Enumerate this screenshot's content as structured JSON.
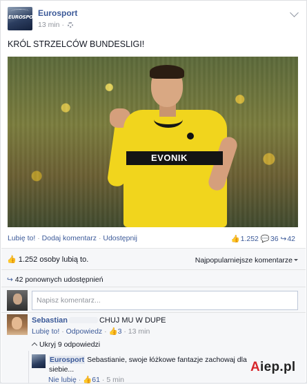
{
  "post": {
    "page_name": "Eurosport",
    "logo_text": "EUROSPORT",
    "timestamp": "13 min",
    "meta_sep": "·",
    "text": "KRÓL STRZELCÓW BUNDESLIGI!",
    "photo_icon": "player-photo",
    "photo_sponsor": "EVONIK"
  },
  "actions": {
    "like": "Lubię to!",
    "comment": "Dodaj komentarz",
    "share": "Udostępnij",
    "sep": "·",
    "like_count": "1.252",
    "comment_count": "36",
    "share_count": "42",
    "like_icon": "thumbs-up-icon",
    "comment_icon": "comment-icon",
    "share_icon": "share-icon"
  },
  "summary": {
    "likes_text": "1.252 osoby lubią to.",
    "sort_label": "Najpopularniejsze komentarze",
    "shares_text": "42 ponownych udostępnień"
  },
  "composer": {
    "placeholder": "Napisz komentarz..."
  },
  "comments": [
    {
      "author": "Sebastian",
      "text": "CHUJ MU W DUPE",
      "like": "Lubię to!",
      "reply": "Odpowiedz",
      "likes": "3",
      "time": "13 min",
      "hide_replies": "Ukryj 9 odpowiedzi"
    }
  ],
  "replies": [
    {
      "author": "Eurosport",
      "text": "Sebastianie, swoje łóżkowe fantazje zachowaj dla siebie...",
      "unlike": "Nie lubię",
      "likes": "61",
      "time": "5 min"
    }
  ],
  "watermark": {
    "prefix": "",
    "red": "A",
    "rest": "iep.pl"
  },
  "colors": {
    "link": "#3b5998",
    "muted": "#90949c",
    "jersey": "#f1d51d"
  }
}
